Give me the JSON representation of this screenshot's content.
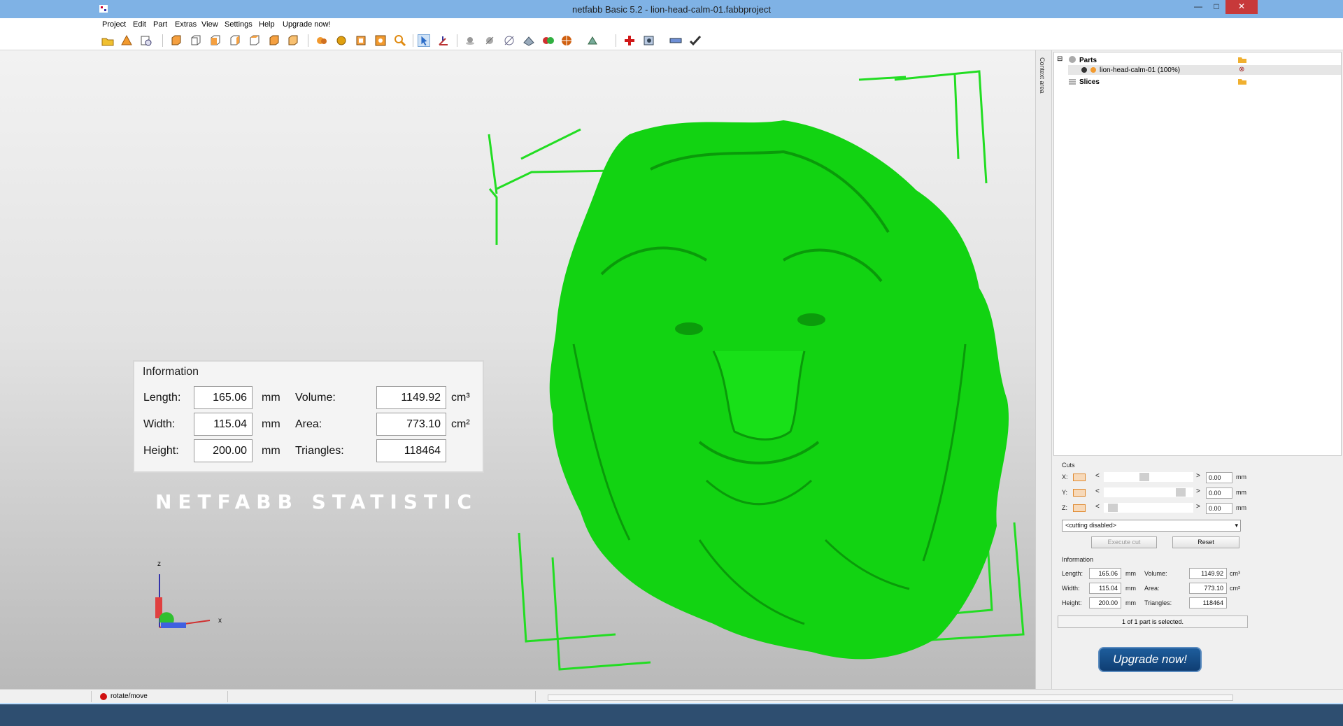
{
  "window": {
    "title": "netfabb Basic 5.2 - lion-head-calm-01.fabbproject",
    "minimize": "—",
    "maximize": "□",
    "close": "✕"
  },
  "menu": [
    "Project",
    "Edit",
    "Part",
    "Extras",
    "View",
    "Settings",
    "Help",
    "Upgrade now!"
  ],
  "toolbar_icons": [
    "open-project-icon",
    "add-part-icon",
    "history-icon",
    "view-front-icon",
    "view-back-icon",
    "view-left-icon",
    "view-right-icon",
    "view-top-icon",
    "view-bottom-icon",
    "render-spheres-icon",
    "render-solid-icon",
    "zoom-all-icon",
    "zoom-selection-icon",
    "search-icon",
    "select-pointer-icon",
    "rotate-icon",
    "shade-icon",
    "shade-smooth-icon",
    "measure-icon",
    "analyze-icon",
    "color-icon",
    "globe-icon",
    "transform-icon",
    "repair-icon",
    "settings-icon",
    "ruler-icon",
    "check-icon"
  ],
  "viewport": {
    "watermark": "NETFABB STATISTIC",
    "axis_z": "z",
    "axis_x": "x",
    "model_color": "#12d312",
    "info": {
      "title": "Information",
      "length_label": "Length:",
      "length_value": "165.06",
      "length_unit": "mm",
      "width_label": "Width:",
      "width_value": "115.04",
      "width_unit": "mm",
      "height_label": "Height:",
      "height_value": "200.00",
      "height_unit": "mm",
      "volume_label": "Volume:",
      "volume_value": "1149.92",
      "volume_unit": "cm³",
      "area_label": "Area:",
      "area_value": "773.10",
      "area_unit": "cm²",
      "triangles_label": "Triangles:",
      "triangles_value": "118464"
    }
  },
  "side_strip": {
    "label": "Context area"
  },
  "tree": {
    "parts": "Parts",
    "part_item": "lion-head-calm-01 (100%)",
    "slices": "Slices"
  },
  "cuts": {
    "title": "Cuts",
    "axes": [
      {
        "label": "X:",
        "value": "0.00",
        "unit": "mm",
        "thumb": 0.45
      },
      {
        "label": "Y:",
        "value": "0.00",
        "unit": "mm",
        "thumb": 0.9
      },
      {
        "label": "Z:",
        "value": "0.00",
        "unit": "mm",
        "thumb": 0.05
      }
    ],
    "left_arrow": "<",
    "right_arrow": ">",
    "mode": "<cutting disabled>",
    "execute": "Execute cut",
    "reset": "Reset"
  },
  "side_info": {
    "title": "Information",
    "length_label": "Length:",
    "length_value": "165.06",
    "length_unit": "mm",
    "width_label": "Width:",
    "width_value": "115.04",
    "width_unit": "mm",
    "height_label": "Height:",
    "height_value": "200.00",
    "height_unit": "mm",
    "volume_label": "Volume:",
    "volume_value": "1149.92",
    "volume_unit": "cm³",
    "area_label": "Area:",
    "area_value": "773.10",
    "area_unit": "cm²",
    "triangles_label": "Triangles:",
    "triangles_value": "118464",
    "selection": "1 of 1 part is selected."
  },
  "upgrade_button": "Upgrade now!",
  "status": {
    "mode": "rotate/move"
  }
}
